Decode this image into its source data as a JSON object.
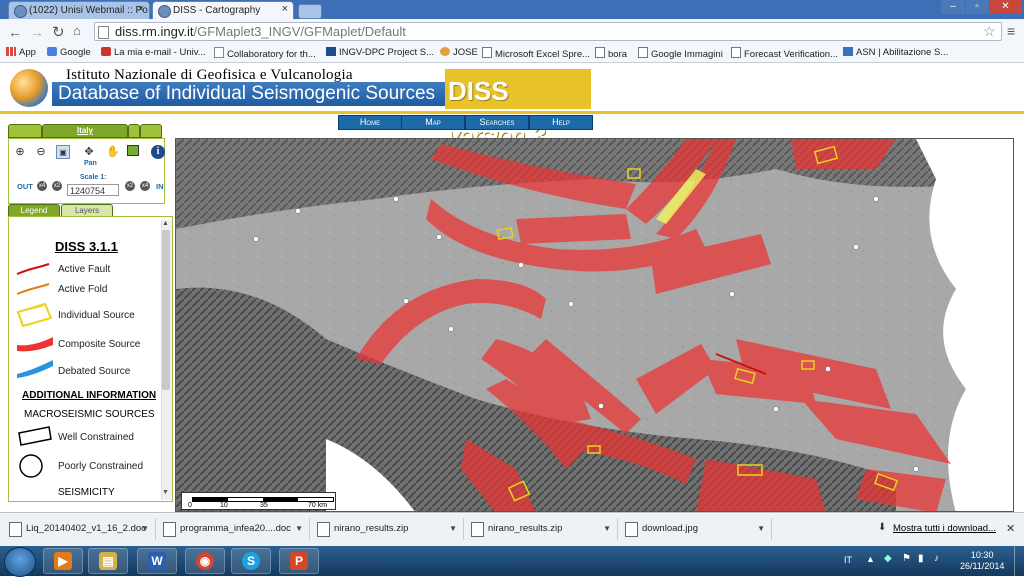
{
  "browser": {
    "tabs": [
      {
        "title": "(1022) Unisi Webmail :: Po",
        "active": false
      },
      {
        "title": "DISS - Cartography",
        "active": true
      }
    ],
    "url_host": "diss.rm.ingv.it",
    "url_path": "/GFMaplet3_INGV/GFMaplet/Default",
    "window_controls": [
      "minimize-icon",
      "maximize-icon",
      "close-icon"
    ]
  },
  "bookmarks": [
    {
      "label": "App",
      "icon": "apps-icon"
    },
    {
      "label": "Google",
      "icon": "google-icon"
    },
    {
      "label": "La mia e-mail - Univ...",
      "icon": "mail-icon"
    },
    {
      "label": "Collaboratory for th...",
      "icon": "page-icon"
    },
    {
      "label": "INGV-DPC Project S...",
      "icon": "page-icon"
    },
    {
      "label": "JOSE",
      "icon": "page-icon"
    },
    {
      "label": "Microsoft Excel Spre...",
      "icon": "folder-icon"
    },
    {
      "label": "bora",
      "icon": "folder-icon"
    },
    {
      "label": "Google Immagini",
      "icon": "folder-icon"
    },
    {
      "label": "Forecast Verification...",
      "icon": "page-icon"
    },
    {
      "label": "ASN | Abilitazione S...",
      "icon": "page-icon"
    }
  ],
  "header": {
    "institute": "Istituto Nazionale di Geofisica e Vulcanologia",
    "database": "Database of Individual Seismogenic Sources",
    "brand": "DISS",
    "version": "version 3",
    "accent_color": "#e8c229",
    "brand_blue": "#1f5ba0"
  },
  "nav": [
    "Home",
    "Map",
    "Searches",
    "Help"
  ],
  "left_panel": {
    "region_tab": "Italy",
    "pan_label": "Pan",
    "scale_label": "Scale 1:",
    "scale_value": "1240754",
    "zoom_out": "OUT",
    "zoom_in": "IN",
    "zoom_steps_out": [
      "x4",
      "x2"
    ],
    "zoom_steps_in": [
      "x2",
      "x4"
    ],
    "tabs": [
      "Legend",
      "Layers"
    ],
    "legend": {
      "title": "DISS 3.1.1",
      "items": [
        {
          "label": "Active Fault",
          "color": "#cc1111"
        },
        {
          "label": "Active Fold",
          "color": "#e87b14"
        },
        {
          "label": "Individual Source",
          "color": "#ecd21a"
        },
        {
          "label": "Composite Source",
          "color": "#ee3333"
        },
        {
          "label": "Debated Source",
          "color": "#2a93e0"
        }
      ],
      "additional_title": "ADDITIONAL INFORMATION",
      "macroseismic_title": "MACROSEISMIC SOURCES",
      "macroseismic_items": [
        "Well Constrained",
        "Poorly Constrained"
      ],
      "seismicity_title": "SEISMICITY"
    }
  },
  "map": {
    "scalebar_labels": [
      "0",
      "10",
      "35",
      "70 km"
    ]
  },
  "downloads": {
    "items": [
      {
        "name": "Liq_20140402_v1_16_2.doc"
      },
      {
        "name": "programma_infea20....doc"
      },
      {
        "name": "nirano_results.zip"
      },
      {
        "name": "nirano_results.zip"
      },
      {
        "name": "download.jpg"
      }
    ],
    "show_all": "Mostra tutti i download..."
  },
  "taskbar": {
    "apps": [
      {
        "icon": "media-player-icon",
        "glyph": "▶"
      },
      {
        "icon": "explorer-icon",
        "glyph": "▤"
      },
      {
        "icon": "word-icon",
        "glyph": "W"
      },
      {
        "icon": "chrome-icon",
        "glyph": "◉"
      },
      {
        "icon": "skype-icon",
        "glyph": "S"
      },
      {
        "icon": "powerpoint-icon",
        "glyph": "P"
      }
    ],
    "language": "IT",
    "time": "10:30",
    "date": "26/11/2014"
  }
}
